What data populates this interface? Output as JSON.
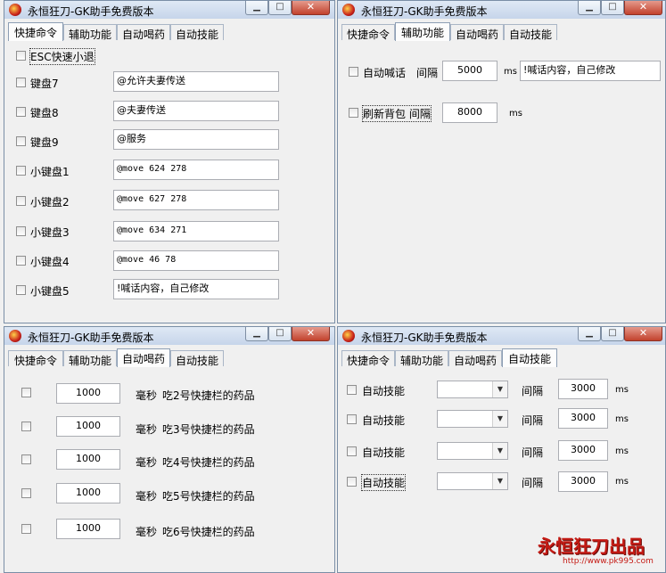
{
  "windows": [
    {
      "title": "永恒狂刀-GK助手免费版本",
      "tabs": [
        "快捷命令",
        "辅助功能",
        "自动喝药",
        "自动技能"
      ],
      "active_tab": 0,
      "esc_label": "ESC快速小退",
      "rows": [
        {
          "label": "键盘7",
          "value": "@允许夫妻传送"
        },
        {
          "label": "键盘8",
          "value": "@夫妻传送"
        },
        {
          "label": "键盘9",
          "value": "@服务"
        },
        {
          "label": "小键盘1",
          "value": "@move 624 278"
        },
        {
          "label": "小键盘2",
          "value": "@move 627 278"
        },
        {
          "label": "小键盘3",
          "value": "@move 634 271"
        },
        {
          "label": "小键盘4",
          "value": "@move 46 78"
        },
        {
          "label": "小键盘5",
          "value": "!喊话内容，自己修改"
        }
      ]
    },
    {
      "title": "永恒狂刀-GK助手免费版本",
      "tabs": [
        "快捷命令",
        "辅助功能",
        "自动喝药",
        "自动技能"
      ],
      "active_tab": 1,
      "shout": {
        "label": "自动喊话",
        "interval_label": "间隔",
        "interval": "5000",
        "unit": "ms",
        "message": "!喊话内容，自己修改"
      },
      "refresh": {
        "label": "刷新背包",
        "interval_label": "间隔",
        "interval": "8000",
        "unit": "ms"
      }
    },
    {
      "title": "永恒狂刀-GK助手免费版本",
      "tabs": [
        "快捷命令",
        "辅助功能",
        "自动喝药",
        "自动技能"
      ],
      "active_tab": 2,
      "unit_label": "毫秒",
      "rows": [
        {
          "value": "1000",
          "desc": "吃2号快捷栏的药品"
        },
        {
          "value": "1000",
          "desc": "吃3号快捷栏的药品"
        },
        {
          "value": "1000",
          "desc": "吃4号快捷栏的药品"
        },
        {
          "value": "1000",
          "desc": "吃5号快捷栏的药品"
        },
        {
          "value": "1000",
          "desc": "吃6号快捷栏的药品"
        }
      ]
    },
    {
      "title": "永恒狂刀-GK助手免费版本",
      "tabs": [
        "快捷命令",
        "辅助功能",
        "自动喝药",
        "自动技能"
      ],
      "active_tab": 3,
      "rows": [
        {
          "label": "自动技能",
          "interval_label": "间隔",
          "value": "3000",
          "unit": "ms"
        },
        {
          "label": "自动技能",
          "interval_label": "间隔",
          "value": "3000",
          "unit": "ms"
        },
        {
          "label": "自动技能",
          "interval_label": "间隔",
          "value": "3000",
          "unit": "ms"
        },
        {
          "label": "自动技能",
          "interval_label": "间隔",
          "value": "3000",
          "unit": "ms"
        }
      ]
    }
  ],
  "watermark": {
    "brand": "永恒狂刀出品",
    "url": "http://www.pk995.com"
  },
  "icons": {
    "minimize": "minimize-icon",
    "maximize": "maximize-icon",
    "close": "close-icon",
    "dropdown": "chevron-down-icon"
  }
}
